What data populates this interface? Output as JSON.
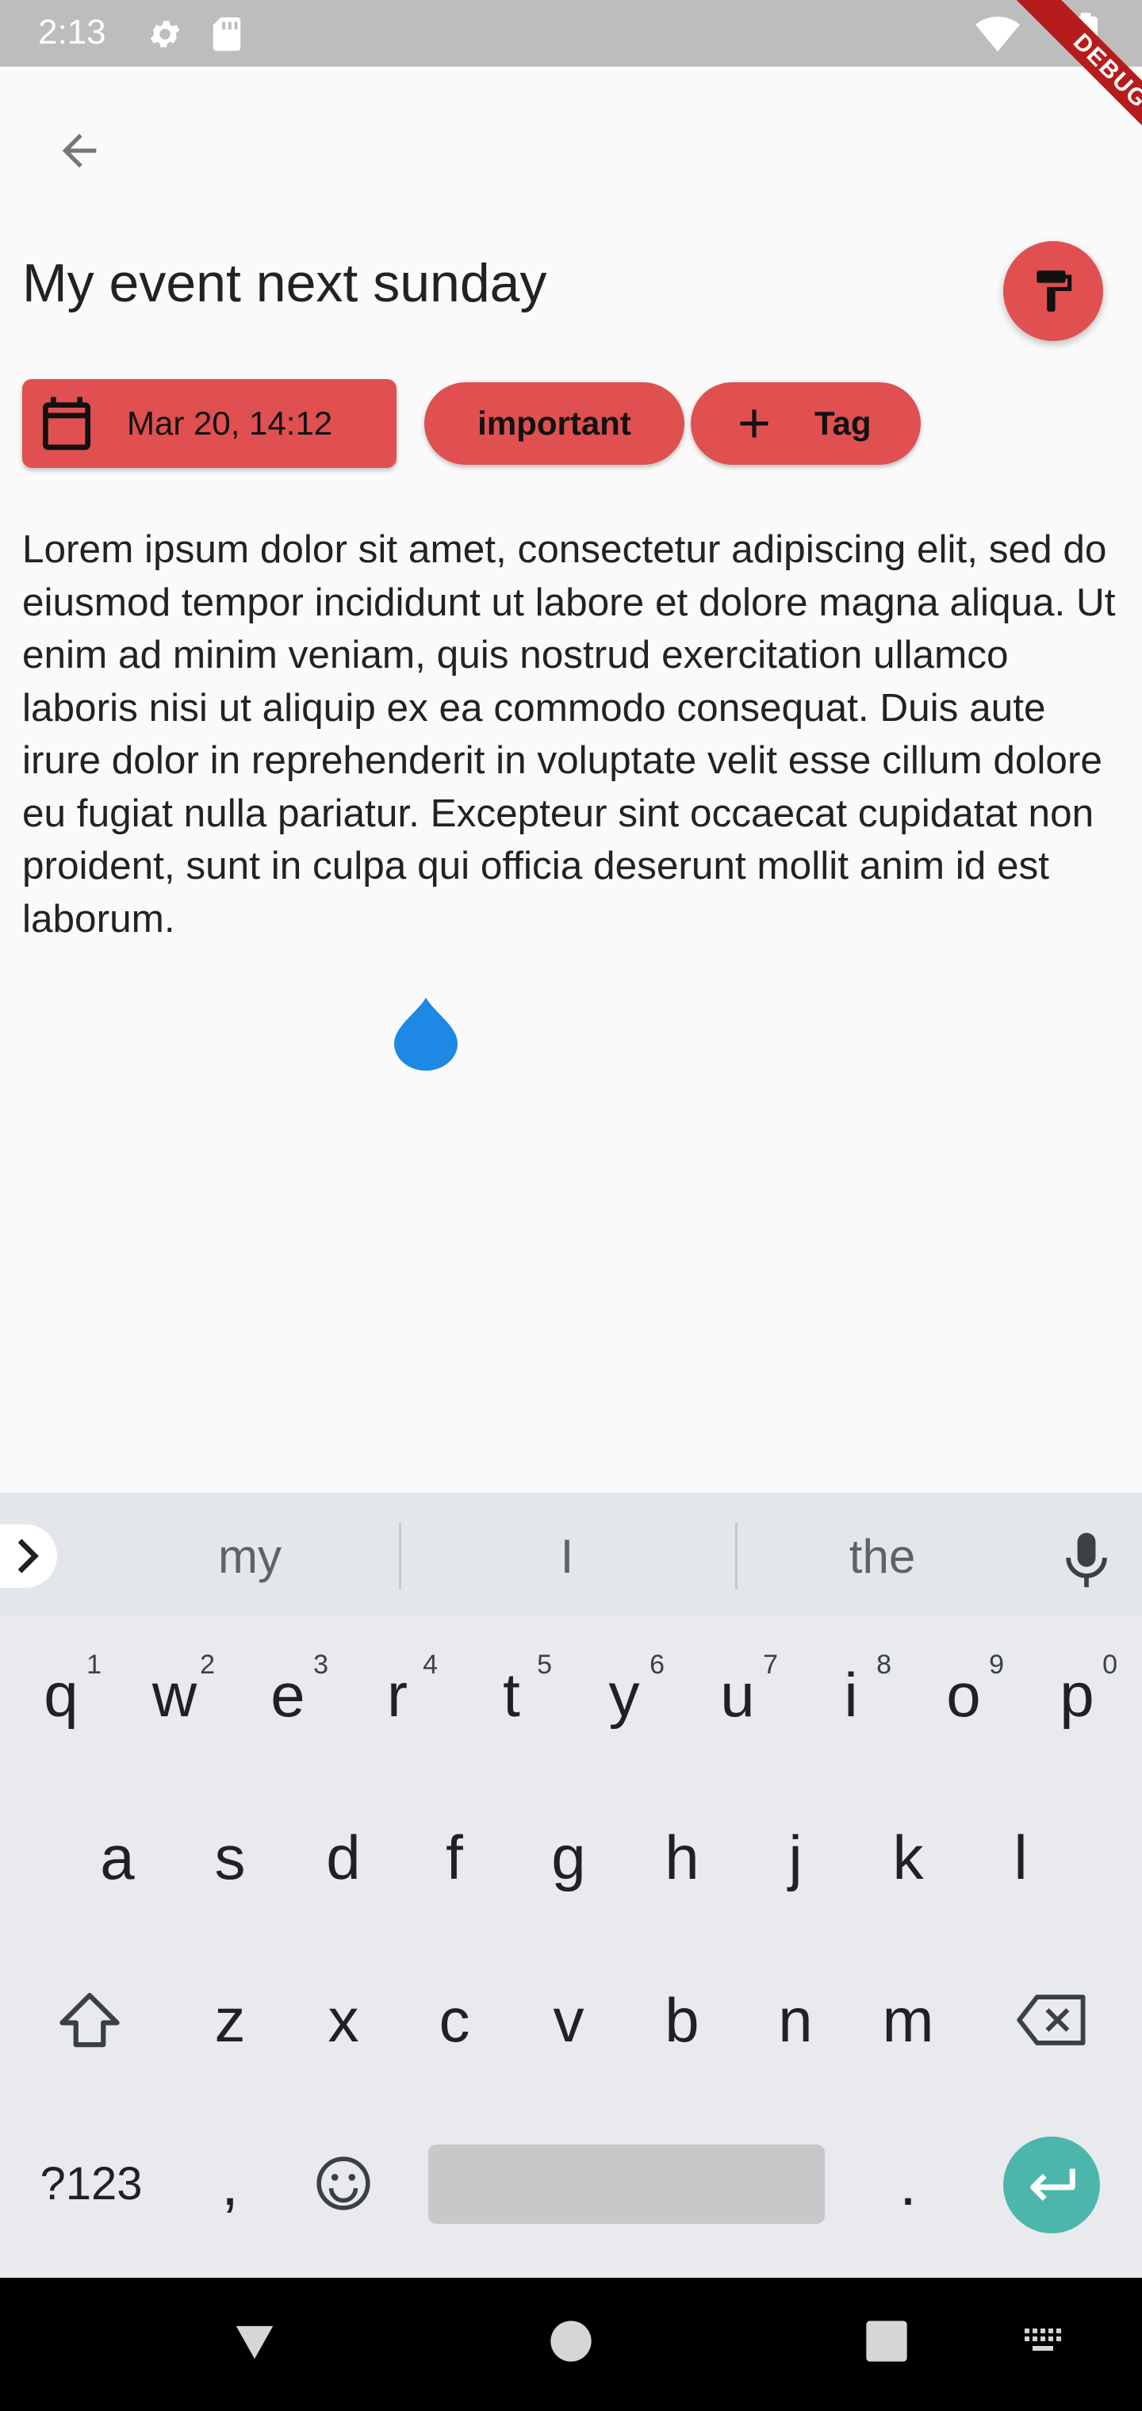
{
  "status_bar": {
    "time": "2:13"
  },
  "debug_banner": {
    "label": "DEBUG"
  },
  "page": {
    "title": "My event next sunday",
    "date_chip_label": "Mar 20, 14:12",
    "tags": [
      "important"
    ],
    "add_tag_label": "Tag",
    "body_text": "Lorem ipsum dolor sit amet, consectetur adipiscing elit, sed do eiusmod tempor incididunt ut labore et dolore magna aliqua. Ut enim ad minim veniam, quis nostrud exercitation ullamco laboris nisi ut aliquip ex ea commodo consequat. Duis aute irure dolor in reprehenderit in voluptate velit esse cillum dolore eu fugiat nulla pariatur. Excepteur sint occaecat cupidatat non proident, sunt in culpa qui officia deserunt mollit anim id est laborum."
  },
  "colors": {
    "accent": "#e05050",
    "cursor": "#1e88e5",
    "enter_key": "#4db6ac"
  },
  "keyboard": {
    "suggestions": [
      "my",
      "I",
      "the"
    ],
    "row1": [
      {
        "key": "q",
        "hint": "1"
      },
      {
        "key": "w",
        "hint": "2"
      },
      {
        "key": "e",
        "hint": "3"
      },
      {
        "key": "r",
        "hint": "4"
      },
      {
        "key": "t",
        "hint": "5"
      },
      {
        "key": "y",
        "hint": "6"
      },
      {
        "key": "u",
        "hint": "7"
      },
      {
        "key": "i",
        "hint": "8"
      },
      {
        "key": "o",
        "hint": "9"
      },
      {
        "key": "p",
        "hint": "0"
      }
    ],
    "row2": [
      "a",
      "s",
      "d",
      "f",
      "g",
      "h",
      "j",
      "k",
      "l"
    ],
    "row3": [
      "z",
      "x",
      "c",
      "v",
      "b",
      "n",
      "m"
    ],
    "symbols_label": "?123",
    "comma": ",",
    "period": "."
  }
}
